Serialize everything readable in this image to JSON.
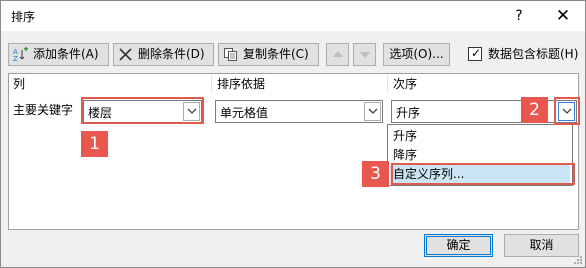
{
  "window": {
    "title": "排序",
    "help_label": "?",
    "close_label": "✕"
  },
  "toolbar": {
    "add_label": "添加条件(A)",
    "delete_label": "删除条件(D)",
    "copy_label": "复制条件(C)",
    "options_label": "选项(O)...",
    "header_checkbox_label": "数据包含标题(H)",
    "header_checkbox_checked": true
  },
  "grid": {
    "columns": [
      "列",
      "排序依据",
      "次序"
    ],
    "row": {
      "label": "主要关键字",
      "column_value": "楼层",
      "sort_on_value": "单元格值",
      "order_value": "升序"
    },
    "order_options": [
      "升序",
      "降序",
      "自定义序列..."
    ],
    "highlighted_option": "自定义序列..."
  },
  "annotations": {
    "badge1": "1",
    "badge2": "2",
    "badge3": "3",
    "accent_color": "#e8584e"
  },
  "footer": {
    "ok_label": "确定",
    "cancel_label": "取消"
  }
}
